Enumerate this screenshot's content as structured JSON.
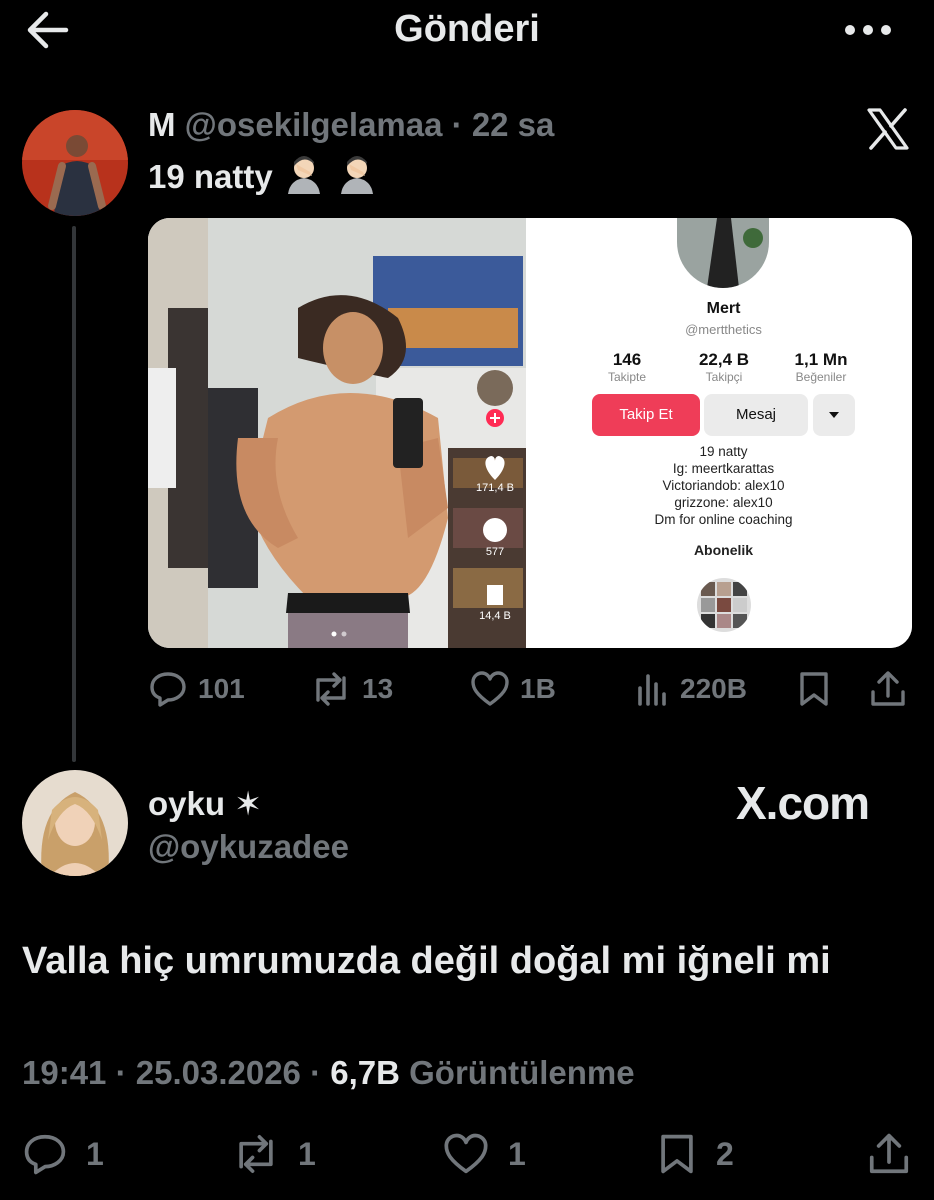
{
  "header": {
    "title": "Gönderi"
  },
  "quoted_tweet": {
    "name": "M",
    "handle": "@osekilgelamaa",
    "time": "22 sa",
    "text": "19 natty",
    "media": {
      "left": {
        "likes": "171,4 B",
        "comments": "577",
        "saves": "14,4 B"
      },
      "right": {
        "profile_name": "Mert",
        "profile_handle": "@mertthetics",
        "stats": [
          {
            "num": "146",
            "label": "Takipte"
          },
          {
            "num": "22,4 B",
            "label": "Takipçi"
          },
          {
            "num": "1,1 Mn",
            "label": "Beğeniler"
          }
        ],
        "follow_label": "Takip Et",
        "message_label": "Mesaj",
        "bio": [
          "19 natty",
          "Ig: meertkarattas",
          "Victoriandob: alex10",
          "grizzone: alex10",
          "Dm for online coaching"
        ],
        "subscription_label": "Abonelik"
      }
    },
    "actions": {
      "replies": "101",
      "reposts": "13",
      "likes": "1B",
      "views": "220B"
    }
  },
  "main_tweet": {
    "name": "oyku ✶",
    "handle": "@oykuzadee",
    "watermark": "X.com",
    "text": "Valla hiç umrumuzda değil doğal mi iğneli mi",
    "time": "19:41",
    "date": "25.03.2026",
    "views_count": "6,7B",
    "views_label": "Görüntülenme",
    "actions": {
      "replies": "1",
      "reposts": "1",
      "likes": "1",
      "bookmarks": "2"
    }
  },
  "icons": [
    "back-arrow-icon",
    "more-icon",
    "x-logo-icon",
    "reply-icon",
    "repost-icon",
    "like-icon",
    "views-icon",
    "bookmark-icon",
    "share-icon"
  ]
}
